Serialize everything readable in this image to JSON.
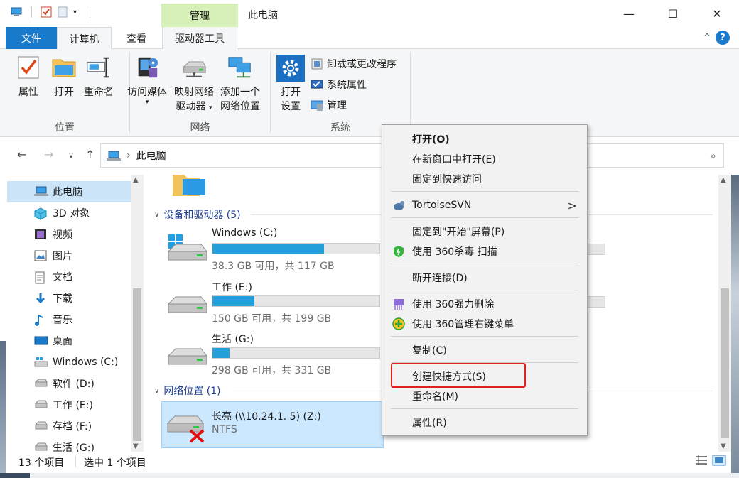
{
  "window": {
    "title": "此电脑",
    "context_tab": "管理",
    "minimize": "—",
    "maximize": "☐",
    "close": "✕"
  },
  "tabs": {
    "file": "文件",
    "computer": "计算机",
    "view": "查看",
    "drive_tools": "驱动器工具",
    "collapse": "^",
    "help": "?"
  },
  "ribbon": {
    "location_group": {
      "label": "位置",
      "properties": "属性",
      "open": "打开",
      "rename": "重命名"
    },
    "network_group": {
      "label": "网络",
      "access_media_l1": "访问媒体",
      "map_drive_l1": "映射网络",
      "map_drive_l2": "驱动器",
      "add_location_l1": "添加一个",
      "add_location_l2": "网络位置"
    },
    "system_group": {
      "label": "系统",
      "open_settings_l1": "打开",
      "open_settings_l2": "设置",
      "uninstall": "卸载或更改程序",
      "system_properties": "系统属性",
      "manage": "管理"
    }
  },
  "address": {
    "path": "此电脑",
    "separator": "›"
  },
  "nav_pane": {
    "items": [
      {
        "label": "此电脑",
        "icon": "pc-icon"
      },
      {
        "label": "3D 对象",
        "icon": "cube-icon"
      },
      {
        "label": "视频",
        "icon": "video-icon"
      },
      {
        "label": "图片",
        "icon": "picture-icon"
      },
      {
        "label": "文档",
        "icon": "document-icon"
      },
      {
        "label": "下载",
        "icon": "download-icon"
      },
      {
        "label": "音乐",
        "icon": "music-icon"
      },
      {
        "label": "桌面",
        "icon": "desktop-icon"
      },
      {
        "label": "Windows (C:)",
        "icon": "windows-drive-icon"
      },
      {
        "label": "软件 (D:)",
        "icon": "drive-icon"
      },
      {
        "label": "工作 (E:)",
        "icon": "drive-icon"
      },
      {
        "label": "存档 (F:)",
        "icon": "drive-icon"
      },
      {
        "label": "生活 (G:)",
        "icon": "drive-icon"
      }
    ]
  },
  "content": {
    "devices_header": "设备和驱动器 (5)",
    "network_header": "网络位置 (1)",
    "drives": [
      {
        "name": "Windows (C:)",
        "free": "38.3 GB 可用，共 117 GB",
        "used_fraction": 0.67
      },
      {
        "name": "工作 (E:)",
        "free": "150 GB 可用，共 199 GB",
        "used_fraction": 0.25
      },
      {
        "name": "生活 (G:)",
        "free": "298 GB 可用，共 331 GB",
        "used_fraction": 0.1
      }
    ],
    "network_drive": {
      "name": "长亮 (\\\\10.24.1. 5) (Z:)",
      "fs": "NTFS"
    }
  },
  "status": {
    "count": "13 个项目",
    "selected": "选中 1 个项目"
  },
  "context_menu": {
    "items": [
      {
        "label": "打开(O)",
        "bold": true
      },
      {
        "label": "在新窗口中打开(E)"
      },
      {
        "label": "固定到快速访问"
      },
      {
        "label": "TortoiseSVN",
        "submenu": true,
        "icon": "tortoisesvn-icon"
      },
      {
        "label": "固定到\"开始\"屏幕(P)"
      },
      {
        "label": "使用 360杀毒 扫描",
        "icon": "shield-360-icon"
      },
      {
        "label": "断开连接(D)"
      },
      {
        "label": "使用 360强力删除",
        "icon": "shredder-360-icon"
      },
      {
        "label": "使用 360管理右键菜单",
        "icon": "plus-360-icon"
      },
      {
        "label": "复制(C)"
      },
      {
        "label": "创建快捷方式(S)",
        "highlighted": true
      },
      {
        "label": "重命名(M)"
      },
      {
        "label": "属性(R)"
      }
    ],
    "submenu_arrow": ">"
  }
}
